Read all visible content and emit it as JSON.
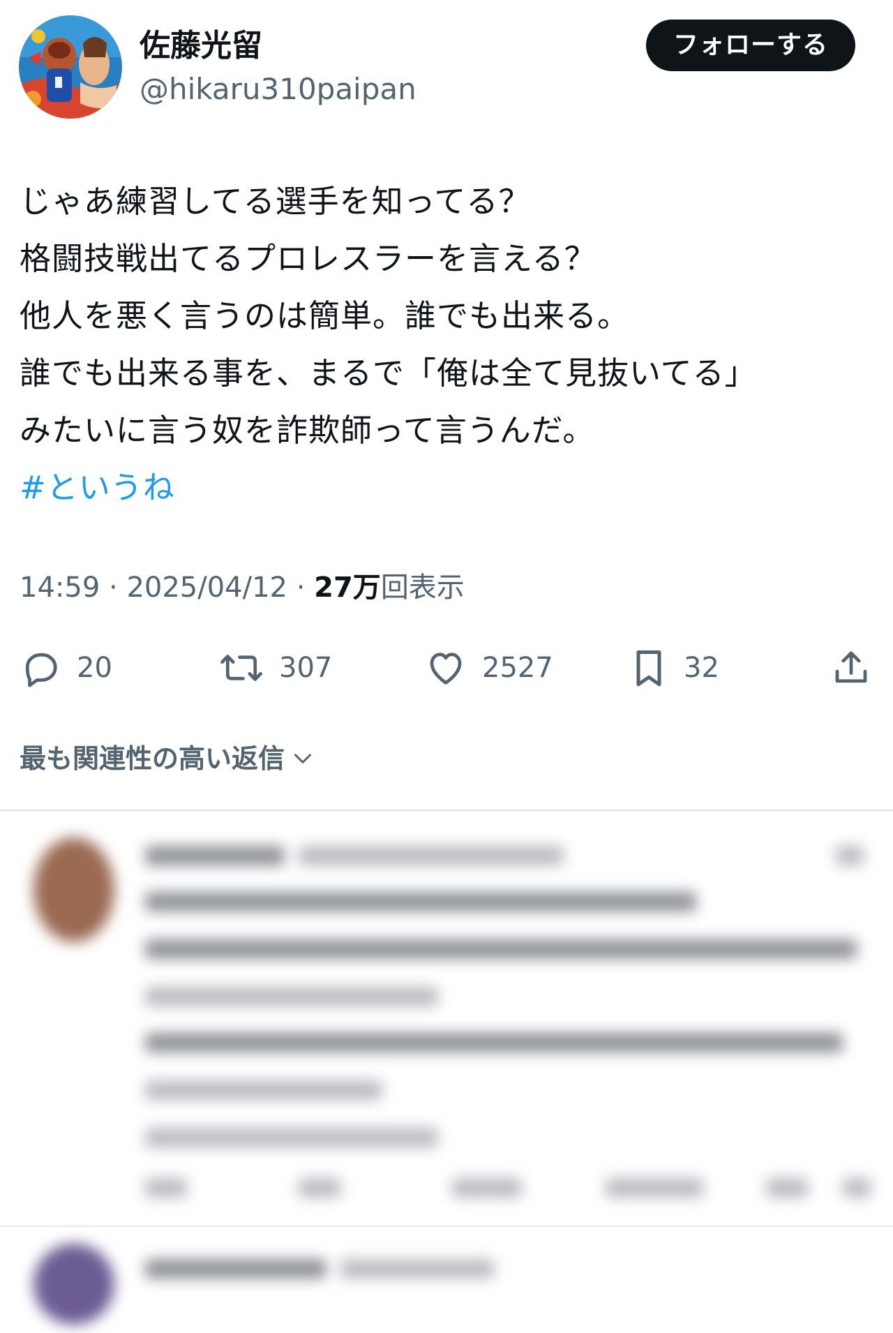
{
  "author": {
    "display_name": "佐藤光留",
    "handle": "@hikaru310paipan"
  },
  "follow_button": {
    "label": "フォローする"
  },
  "tweet": {
    "lines": [
      "じゃあ練習してる選手を知ってる？",
      "格闘技戦出てるプロレスラーを言える？",
      "他人を悪く言うのは簡単。誰でも出来る。",
      "誰でも出来る事を、まるで「俺は全て見抜いてる」",
      "みたいに言う奴を詐欺師って言うんだ。"
    ],
    "hashtag": "#というね"
  },
  "meta": {
    "time": "14:59",
    "separator": " · ",
    "date": "2025/04/12",
    "views_count": "27万",
    "views_label": "回表示"
  },
  "actions": {
    "reply": {
      "icon": "reply-icon",
      "count": "20"
    },
    "retweet": {
      "icon": "retweet-icon",
      "count": "307"
    },
    "like": {
      "icon": "heart-icon",
      "count": "2527"
    },
    "bookmark": {
      "icon": "bookmark-icon",
      "count": "32"
    },
    "share": {
      "icon": "share-icon"
    }
  },
  "replies_sort": {
    "label": "最も関連性の高い返信"
  },
  "colors": {
    "text": "#0f1419",
    "secondary": "#536471",
    "link": "#1d9bf0",
    "button_bg": "#0f1419",
    "button_text": "#ffffff",
    "divider": "#d9dde1"
  }
}
